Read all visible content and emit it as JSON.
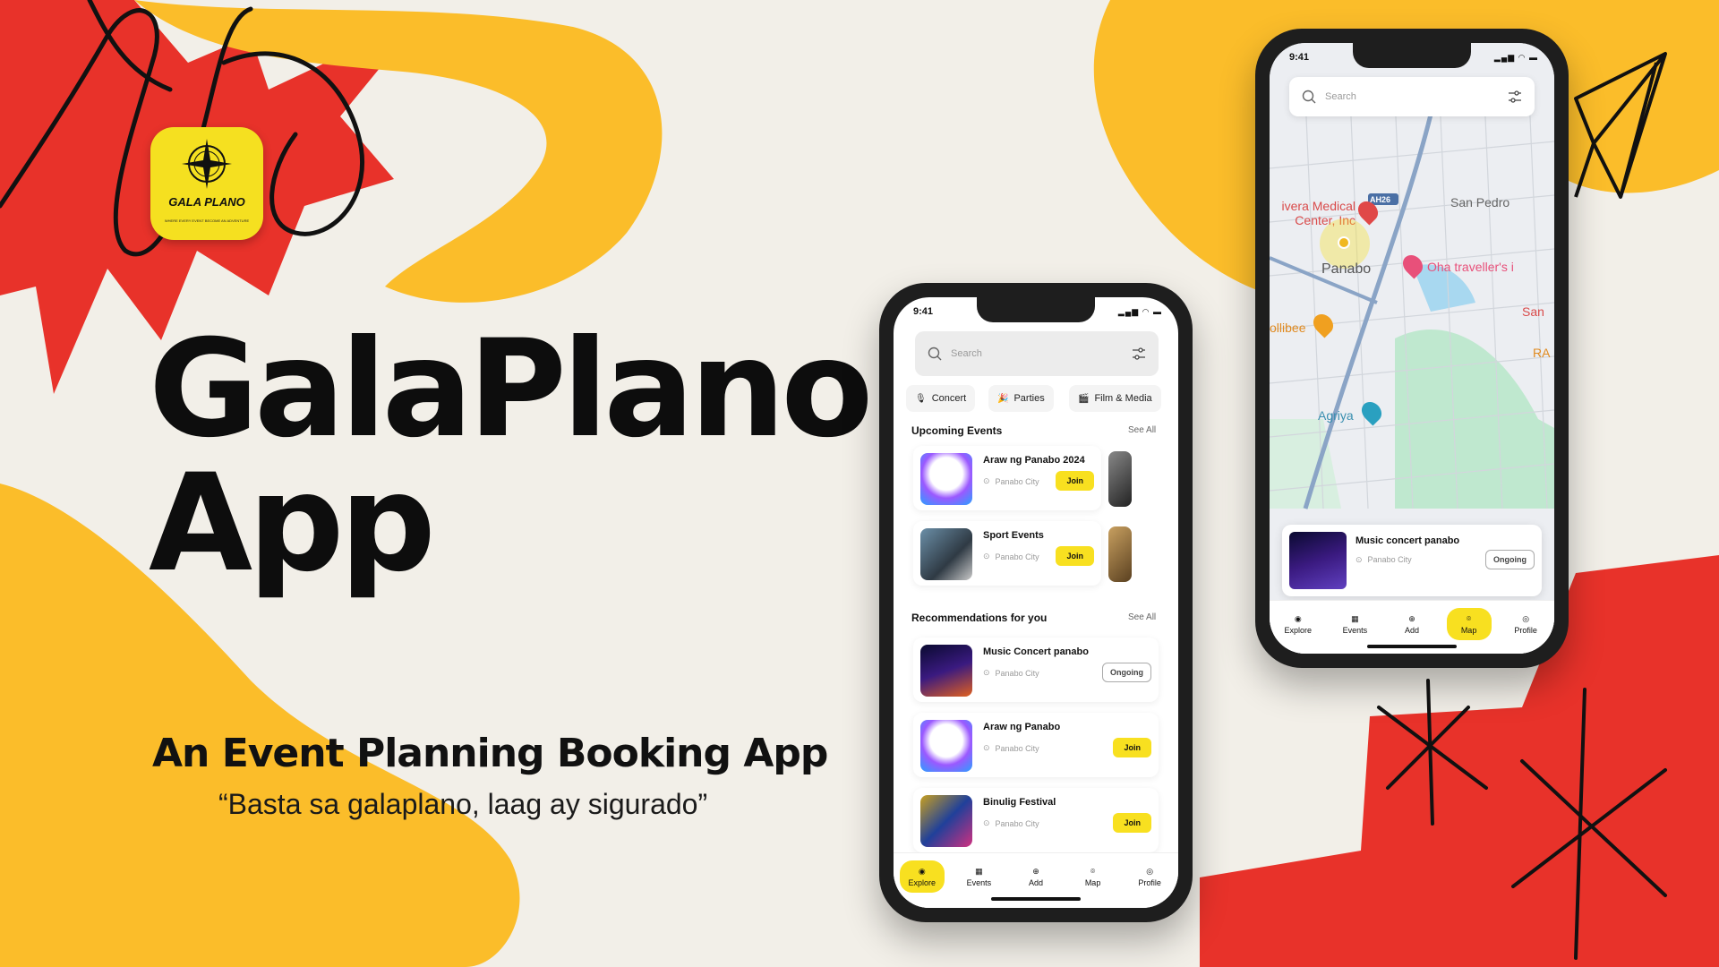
{
  "colors": {
    "background": "#f2efe8",
    "accent_yellow": "#fbbd2a",
    "accent_red": "#e8322a",
    "button_yellow": "#f8e020"
  },
  "logo": {
    "name": "GALA PLANO",
    "tagline": "WHERE EVERY EVENT BECOME AN ADVENTURE",
    "icon": "compass-icon"
  },
  "hero": {
    "title_line1": "GalaPlano",
    "title_line2": "App",
    "subtitle": "An Event Planning Booking App",
    "quote": "“Basta sa galaplano, laag ay sigurado”"
  },
  "phone_explore": {
    "time": "9:41",
    "search_placeholder": "Search",
    "categories": [
      {
        "label": "Concert",
        "icon": "microphone-icon"
      },
      {
        "label": "Parties",
        "icon": "party-icon"
      },
      {
        "label": "Film & Media",
        "icon": "film-icon"
      }
    ],
    "upcoming": {
      "title": "Upcoming Events",
      "see_all": "See All",
      "items": [
        {
          "title": "Araw ng Panabo 2024",
          "location": "Panabo City",
          "action": "Join"
        },
        {
          "title": "Sport Events",
          "location": "Panabo City",
          "action": "Join"
        }
      ]
    },
    "recommendations": {
      "title": "Recommendations for you",
      "see_all": "See All",
      "items": [
        {
          "title": "Music Concert panabo",
          "location": "Panabo City",
          "action": "Ongoing"
        },
        {
          "title": "Araw ng Panabo",
          "location": "Panabo City",
          "action": "Join"
        },
        {
          "title": "Binulig Festival",
          "location": "Panabo City",
          "action": "Join"
        }
      ]
    },
    "tabs": [
      "Explore",
      "Events",
      "Add",
      "Map",
      "Profile"
    ],
    "active_tab": "Explore"
  },
  "phone_map": {
    "time": "9:41",
    "search_placeholder": "Search",
    "map_labels": {
      "hospital": "ivera Medical Center, Inc",
      "road": "AH26",
      "town1": "San Pedro",
      "city": "Panabo",
      "hotel": "Oha traveller's i",
      "restaurant": "ollibee",
      "town2": "San",
      "other": "RA",
      "place": "Agriya"
    },
    "event_card": {
      "title": "Music concert panabo",
      "location": "Panabo City",
      "status": "Ongoing"
    },
    "tabs": [
      "Explore",
      "Events",
      "Add",
      "Map",
      "Profile"
    ],
    "active_tab": "Map"
  }
}
